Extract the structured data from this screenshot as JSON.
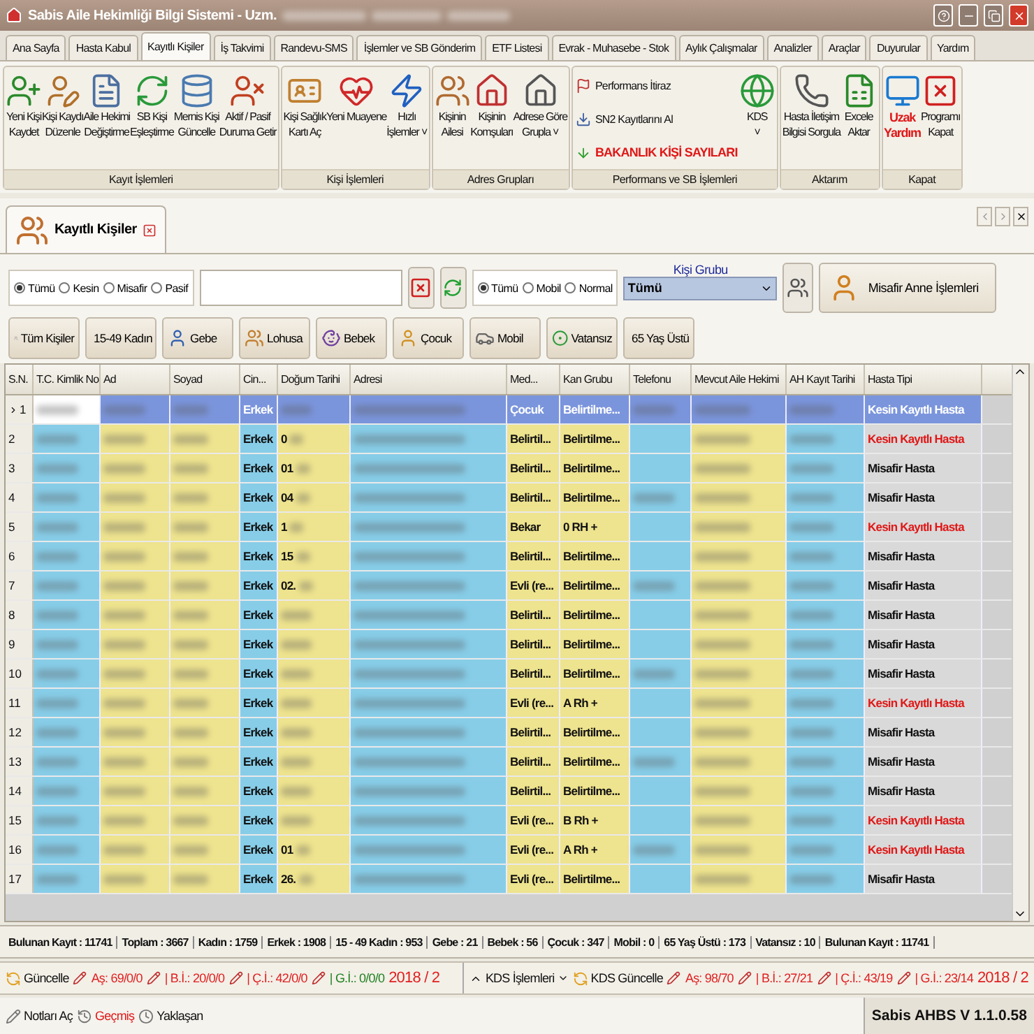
{
  "window": {
    "title": "Sabis Aile Hekimliği Bilgi Sistemi  -  Uzm."
  },
  "menu_tabs": [
    {
      "label": "Ana Sayfa",
      "selected": false
    },
    {
      "label": "Hasta Kabul",
      "selected": false
    },
    {
      "label": "Kayıtlı Kişiler",
      "selected": true
    },
    {
      "label": "İş Takvimi",
      "selected": false
    },
    {
      "label": "Randevu-SMS",
      "selected": false
    },
    {
      "label": "İşlemler ve SB Gönderim",
      "selected": false
    },
    {
      "label": "ETF Listesi",
      "selected": false
    },
    {
      "label": "Evrak - Muhasebe - Stok",
      "selected": false
    },
    {
      "label": "Aylık Çalışmalar",
      "selected": false
    },
    {
      "label": "Analizler",
      "selected": false
    },
    {
      "label": "Araçlar",
      "selected": false
    },
    {
      "label": "Duyurular",
      "selected": false
    },
    {
      "label": "Yardım",
      "selected": false
    }
  ],
  "ribbon_groups": [
    {
      "label": "Kayıt İşlemleri",
      "items": [
        {
          "kind": "large",
          "lines": [
            "Yeni Kişi",
            "Kaydet"
          ],
          "alert": false
        },
        {
          "kind": "large",
          "lines": [
            "Kişi Kaydı",
            "Düzenle"
          ],
          "alert": false
        },
        {
          "kind": "large",
          "lines": [
            "Aile Hekimi",
            "Değiştirme"
          ],
          "alert": false
        },
        {
          "kind": "large",
          "lines": [
            "SB Kişi",
            "Eşleştirme"
          ],
          "alert": false
        },
        {
          "kind": "large",
          "lines": [
            "Mernis Kişi",
            "Güncelle"
          ],
          "alert": false
        },
        {
          "kind": "large",
          "lines": [
            "Aktif / Pasif",
            "Duruma Getir"
          ],
          "alert": false
        }
      ]
    },
    {
      "label": "Kişi İşlemleri",
      "items": [
        {
          "kind": "large",
          "lines": [
            "Kişi Sağlık",
            "Kartı Aç"
          ],
          "alert": false
        },
        {
          "kind": "large",
          "lines": [
            "Yeni Muayene"
          ],
          "alert": false
        },
        {
          "kind": "large",
          "lines": [
            "Hızlı",
            "İşlemler ˅"
          ],
          "alert": false
        }
      ]
    },
    {
      "label": "Adres Grupları",
      "items": [
        {
          "kind": "large",
          "lines": [
            "Kişinin",
            "Ailesi"
          ],
          "alert": false
        },
        {
          "kind": "large",
          "lines": [
            "Kişinin",
            "Komşuları"
          ],
          "alert": false
        },
        {
          "kind": "large",
          "lines": [
            "Adrese Göre",
            "Grupla ˅"
          ],
          "alert": false
        }
      ]
    },
    {
      "label": "Performans ve SB İşlemleri",
      "items": [
        {
          "kind": "small",
          "lines": [
            "Performans İtiraz"
          ],
          "alert": false
        },
        {
          "kind": "small",
          "lines": [
            "SN2 Kayıtlarını Al"
          ],
          "alert": false
        },
        {
          "kind": "small",
          "lines": [
            "BAKANLIK KİŞİ SAYILARI"
          ],
          "alert": true
        },
        {
          "kind": "large",
          "lines": [
            "KDS",
            "˅"
          ],
          "alert": false
        }
      ]
    },
    {
      "label": "Aktarım",
      "items": [
        {
          "kind": "large",
          "lines": [
            "Hasta İletişim",
            "Bilgisi Sorgula"
          ],
          "alert": false
        },
        {
          "kind": "large",
          "lines": [
            "Excele",
            "Aktar"
          ],
          "alert": false
        }
      ]
    },
    {
      "label": "Kapat",
      "items": [
        {
          "kind": "large",
          "lines": [
            "Uzak",
            "Yardım"
          ],
          "alert": true
        },
        {
          "kind": "large",
          "lines": [
            "Programı",
            "Kapat"
          ],
          "alert": false
        }
      ]
    }
  ],
  "doc_tab": {
    "title": "Kayıtlı Kişiler",
    "selected": true
  },
  "record_filter": [
    {
      "label": "Tümü",
      "selected": true
    },
    {
      "label": "Kesin",
      "selected": false
    },
    {
      "label": "Misafir",
      "selected": false
    },
    {
      "label": "Pasif",
      "selected": false
    }
  ],
  "mobile_filter": [
    {
      "label": "Tümü",
      "selected": true
    },
    {
      "label": "Mobil",
      "selected": false
    },
    {
      "label": "Normal",
      "selected": false
    }
  ],
  "kisi_grubu": {
    "label": "Kişi Grubu",
    "value": "Tümü"
  },
  "misafir_anne_button": "Misafir Anne İşlemleri",
  "quick_filters": [
    "Tüm Kişiler",
    "15-49 Kadın",
    "Gebe",
    "Lohusa",
    "Bebek",
    "Çocuk",
    "Mobil",
    "Vatansız",
    "65 Yaş Üstü"
  ],
  "table": {
    "columns": [
      "S.N.",
      "T.C. Kimlik No",
      "Ad",
      "Soyad",
      "Cin...",
      "Doğum Tarihi",
      "Adresi",
      "Med...",
      "Kan Grubu",
      "Telefonu",
      "Mevcut Aile Hekimi",
      "AH Kayıt Tarihi",
      "Hasta Tipi"
    ],
    "rows": [
      {
        "sn": "1",
        "gender": "Erkek",
        "birth": "",
        "marital": "Çocuk",
        "blood": "Belirtilme...",
        "type": "Kesin Kayıtlı Hasta",
        "kind": "kesin",
        "selected": true
      },
      {
        "sn": "2",
        "gender": "Erkek",
        "birth": "0",
        "marital": "Belirtil...",
        "blood": "Belirtilme...",
        "type": "Kesin Kayıtlı Hasta",
        "kind": "kesin",
        "selected": false
      },
      {
        "sn": "3",
        "gender": "Erkek",
        "birth": "01",
        "marital": "Belirtil...",
        "blood": "Belirtilme...",
        "type": "Misafir Hasta",
        "kind": "misafir",
        "selected": false
      },
      {
        "sn": "4",
        "gender": "Erkek",
        "birth": "04",
        "marital": "Belirtil...",
        "blood": "Belirtilme...",
        "type": "Misafir Hasta",
        "kind": "misafir",
        "selected": false
      },
      {
        "sn": "5",
        "gender": "Erkek",
        "birth": "1",
        "marital": "Bekar",
        "blood": "0 RH +",
        "type": "Kesin Kayıtlı Hasta",
        "kind": "kesin",
        "selected": false
      },
      {
        "sn": "6",
        "gender": "Erkek",
        "birth": "15",
        "marital": "Belirtil...",
        "blood": "Belirtilme...",
        "type": "Misafir Hasta",
        "kind": "misafir",
        "selected": false
      },
      {
        "sn": "7",
        "gender": "Erkek",
        "birth": "02.",
        "marital": "Evli (re...",
        "blood": "Belirtilme...",
        "type": "Misafir Hasta",
        "kind": "misafir",
        "selected": false
      },
      {
        "sn": "8",
        "gender": "Erkek",
        "birth": "",
        "marital": "Belirtil...",
        "blood": "Belirtilme...",
        "type": "Misafir Hasta",
        "kind": "misafir",
        "selected": false
      },
      {
        "sn": "9",
        "gender": "Erkek",
        "birth": "",
        "marital": "Belirtil...",
        "blood": "Belirtilme...",
        "type": "Misafir Hasta",
        "kind": "misafir",
        "selected": false
      },
      {
        "sn": "10",
        "gender": "Erkek",
        "birth": "",
        "marital": "Belirtil...",
        "blood": "Belirtilme...",
        "type": "Misafir Hasta",
        "kind": "misafir",
        "selected": false
      },
      {
        "sn": "11",
        "gender": "Erkek",
        "birth": "",
        "marital": "Evli (re...",
        "blood": "A Rh +",
        "type": "Kesin Kayıtlı Hasta",
        "kind": "kesin",
        "selected": false
      },
      {
        "sn": "12",
        "gender": "Erkek",
        "birth": "",
        "marital": "Belirtil...",
        "blood": "Belirtilme...",
        "type": "Misafir Hasta",
        "kind": "misafir",
        "selected": false
      },
      {
        "sn": "13",
        "gender": "Erkek",
        "birth": "",
        "marital": "Belirtil...",
        "blood": "Belirtilme...",
        "type": "Misafir Hasta",
        "kind": "misafir",
        "selected": false
      },
      {
        "sn": "14",
        "gender": "Erkek",
        "birth": "",
        "marital": "Belirtil...",
        "blood": "Belirtilme...",
        "type": "Misafir Hasta",
        "kind": "misafir",
        "selected": false
      },
      {
        "sn": "15",
        "gender": "Erkek",
        "birth": "",
        "marital": "Evli (re...",
        "blood": "B Rh +",
        "type": "Kesin Kayıtlı Hasta",
        "kind": "kesin",
        "selected": false
      },
      {
        "sn": "16",
        "gender": "Erkek",
        "birth": "01",
        "marital": "Evli (re...",
        "blood": "A Rh +",
        "type": "Kesin Kayıtlı Hasta",
        "kind": "kesin",
        "selected": false
      },
      {
        "sn": "17",
        "gender": "Erkek",
        "birth": "26.",
        "marital": "Evli (re...",
        "blood": "Belirtilme...",
        "type": "Misafir Hasta",
        "kind": "misafir",
        "selected": false
      }
    ]
  },
  "summary": [
    "Bulunan Kayıt : 11741",
    "Toplam : 3667",
    "Kadın : 1759",
    "Erkek : 1908",
    "15 - 49 Kadın : 953",
    "Gebe : 21",
    "Bebek : 56",
    "Çocuk : 347",
    "Mobil : 0",
    "65 Yaş Üstü : 173",
    "Vatansız : 10",
    "Bulunan Kayıt : 11741"
  ],
  "status_left": [
    {
      "kind": "button",
      "text": "Güncelle"
    },
    {
      "kind": "stat",
      "text": "Aş: 69/0/0",
      "color": "#e02020"
    },
    {
      "kind": "stat",
      "text": "| B.İ.: 20/0/0",
      "color": "#e02020"
    },
    {
      "kind": "stat",
      "text": "| Ç.İ.: 42/0/0",
      "color": "#e02020"
    },
    {
      "kind": "stat",
      "text": "| G.İ.: 0/0/0",
      "color": "#208020"
    },
    {
      "kind": "period",
      "text": "2018 / 2",
      "color": "#e02020"
    }
  ],
  "status_right": [
    {
      "kind": "menu",
      "text": "KDS İşlemleri"
    },
    {
      "kind": "button",
      "text": "KDS Güncelle"
    },
    {
      "kind": "stat",
      "text": "Aş: 98/70",
      "color": "#e02020"
    },
    {
      "kind": "stat",
      "text": "| B.İ.: 27/21",
      "color": "#e02020"
    },
    {
      "kind": "stat",
      "text": "| Ç.İ.: 43/19",
      "color": "#e02020"
    },
    {
      "kind": "stat",
      "text": "| G.İ.: 23/14",
      "color": "#e02020"
    },
    {
      "kind": "period",
      "text": "2018 / 2",
      "color": "#e02020"
    }
  ],
  "bottom_links": [
    {
      "text": "Notları Aç",
      "alert": false
    },
    {
      "text": "Geçmiş",
      "alert": true
    },
    {
      "text": "Yaklaşan",
      "alert": false
    }
  ],
  "version": "Sabis AHBS V 1.1.0.58"
}
